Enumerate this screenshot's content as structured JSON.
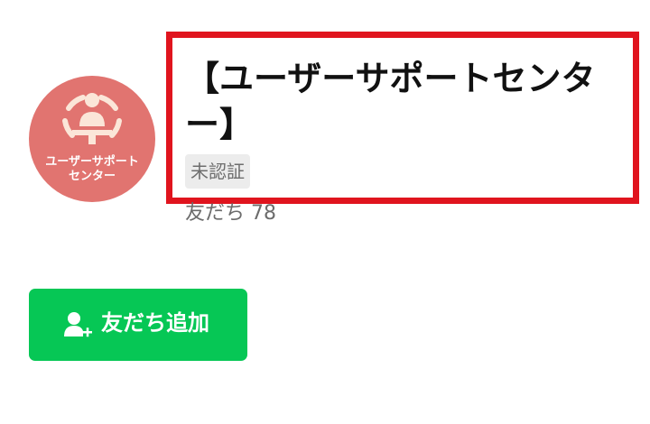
{
  "profile": {
    "avatar_lines": [
      "ユーザーサポート",
      "センター"
    ],
    "avatar_color": "#e17470",
    "name": "【ユーザーサポートセンター】",
    "badge": "未認証",
    "friends": "友だち 78",
    "highlight_color": "#e0141e"
  },
  "actions": {
    "add_friend_label": "友だち追加",
    "add_friend_icon": "add-user-icon",
    "button_color": "#06c755"
  }
}
